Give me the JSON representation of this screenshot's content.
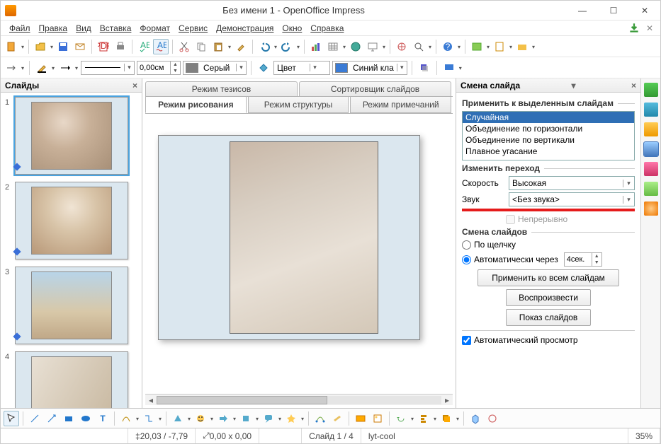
{
  "window": {
    "title": "Без имени 1 - OpenOffice Impress"
  },
  "menu": {
    "file": "Файл",
    "edit": "Правка",
    "view": "Вид",
    "insert": "Вставка",
    "format": "Формат",
    "tools": "Сервис",
    "slideshow": "Демонстрация",
    "window": "Окно",
    "help": "Справка"
  },
  "toolbar2": {
    "line_width": "0,00см",
    "gray_label": "Серый",
    "gray_hex": "#808080",
    "color_label": "Цвет",
    "blue_label": "Синий кла",
    "blue_hex": "#3a7bd5"
  },
  "slide_panel": {
    "title": "Слайды",
    "slides": [
      "1",
      "2",
      "3",
      "4"
    ],
    "selected": 0
  },
  "center_tabs": {
    "outline_top1": "Режим тезисов",
    "outline_top2": "Сортировщик слайдов",
    "draw": "Режим рисования",
    "structure": "Режим структуры",
    "notes": "Режим примечаний"
  },
  "task_panel": {
    "title": "Смена слайда",
    "apply_label": "Применить к выделенным слайдам",
    "transitions": [
      "Случайная",
      "Объединение по горизонтали",
      "Объединение по вертикали",
      "Плавное угасание"
    ],
    "transitions_sel": 0,
    "modify_label": "Изменить переход",
    "speed_label": "Скорость",
    "speed_value": "Высокая",
    "sound_label": "Звук",
    "sound_value": "<Без звука>",
    "loop_label": "Непрерывно",
    "advance_label": "Смена слайдов",
    "on_click": "По щелчку",
    "auto_after": "Автоматически через",
    "auto_value": "4сек.",
    "apply_all": "Применить ко всем слайдам",
    "play": "Воспроизвести",
    "show": "Показ слайдов",
    "auto_preview": "Автоматический просмотр"
  },
  "status": {
    "coords": "20,03 / -7,79",
    "size": "0,00 x 0,00",
    "slide": "Слайд 1 / 4",
    "template": "lyt-cool",
    "zoom": "35%"
  }
}
